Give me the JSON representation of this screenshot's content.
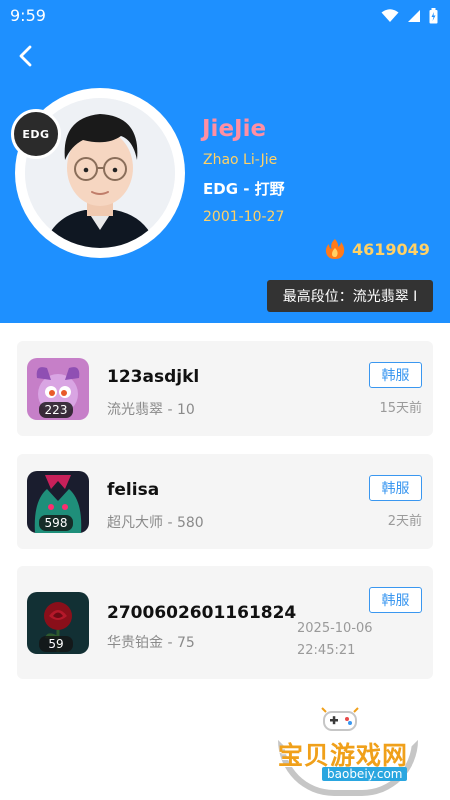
{
  "status_bar": {
    "time": "9:59"
  },
  "profile": {
    "nickname": "JieJie",
    "real_name": "Zhao Li-Jie",
    "team_role": "EDG - 打野",
    "birthday": "2001-10-27",
    "popularity": "4619049",
    "highest_rank": "最高段位：流光翡翠 I",
    "team_logo_text": "EDG"
  },
  "accounts": [
    {
      "name": "123asdjkl",
      "rank": "流光翡翠 - 10",
      "level": "223",
      "server": "韩服",
      "time": "15天前"
    },
    {
      "name": "felisa",
      "rank": "超凡大师 - 580",
      "level": "598",
      "server": "韩服",
      "time": "2天前"
    },
    {
      "name": "2700602601161824",
      "rank": "华贵铂金 - 75",
      "level": "59",
      "server": "韩服",
      "time_date": "2025-10-06",
      "time_clock": "22:45:21"
    }
  ],
  "watermark": {
    "title": "宝贝游戏网",
    "url": "baobeiy.com"
  },
  "colors": {
    "header_bg": "#1e90ff",
    "name_pink": "#ff8fa3",
    "accent_yellow": "#ffd166",
    "server_blue": "#3a97f0"
  }
}
